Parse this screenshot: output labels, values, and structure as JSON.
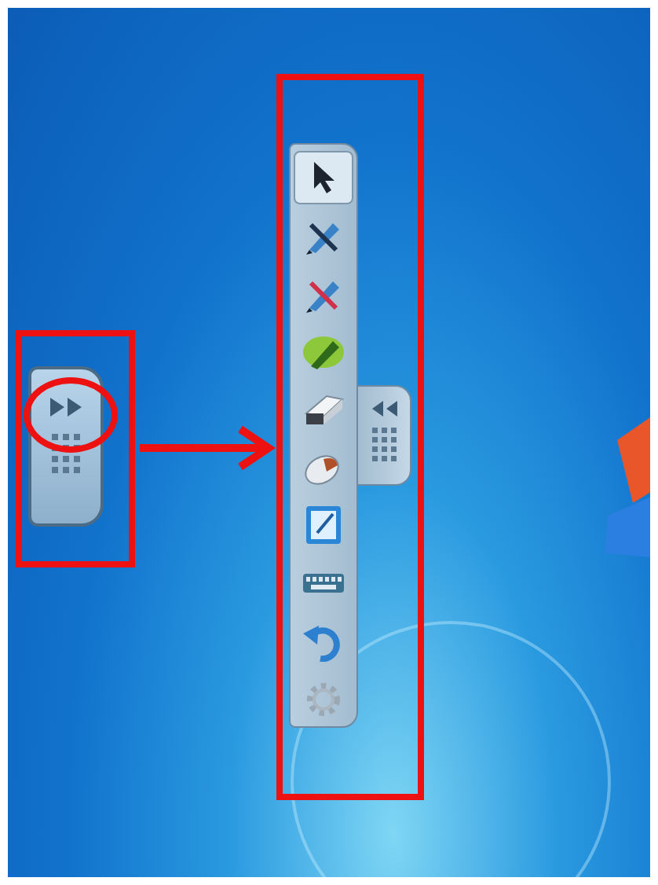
{
  "collapsed_tab": {
    "expanded": false
  },
  "toolbar": {
    "tools": [
      {
        "kind": "pointer",
        "selected": true
      },
      {
        "kind": "pen",
        "selected": false
      },
      {
        "kind": "colorpen",
        "selected": false
      },
      {
        "kind": "highlighter",
        "selected": false
      },
      {
        "kind": "eraser",
        "selected": false
      },
      {
        "kind": "clear",
        "selected": false
      },
      {
        "kind": "whiteboard",
        "selected": false
      },
      {
        "kind": "keyboard",
        "selected": false
      },
      {
        "kind": "undo",
        "selected": false
      },
      {
        "kind": "settings",
        "selected": false
      }
    ]
  }
}
